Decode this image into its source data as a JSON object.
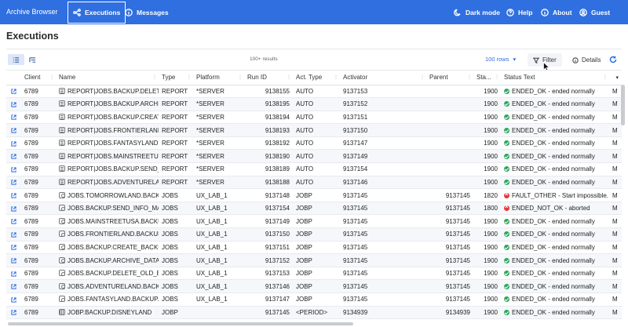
{
  "app": {
    "title": "Archive Browser"
  },
  "nav": {
    "executions": "Executions",
    "messages": "Messages",
    "dark_mode": "Dark mode",
    "help": "Help",
    "about": "About",
    "guest": "Guest"
  },
  "page": {
    "title": "Executions"
  },
  "toolbar": {
    "results": "100+ results",
    "rows": "100 rows",
    "filter": "Filter",
    "details": "Details"
  },
  "colors": {
    "topbar": "#2f6fe0",
    "ok": "#2aa65a",
    "error": "#e03b3b"
  },
  "columns": [
    "Client",
    "Name",
    "Type",
    "Platform",
    "Run ID",
    "Act. Type",
    "Activator",
    "Parent",
    "Sta...",
    "Status Text"
  ],
  "rows": [
    {
      "client": "6789",
      "icon": "report",
      "name": "REPORT|JOBS.BACKUP.DELETE_C",
      "type": "REPORT",
      "platform": "*SERVER",
      "run_id": "9138155",
      "act_type": "AUTO",
      "activator": "9137153",
      "parent": "",
      "sta": "1900",
      "st": "ok",
      "status": "ENDED_OK - ended normally",
      "extra": "M"
    },
    {
      "client": "6789",
      "icon": "report",
      "name": "REPORT|JOBS.BACKUP.ARCHIVE_",
      "type": "REPORT",
      "platform": "*SERVER",
      "run_id": "9138195",
      "act_type": "AUTO",
      "activator": "9137152",
      "parent": "",
      "sta": "1900",
      "st": "ok",
      "status": "ENDED_OK - ended normally",
      "extra": "M"
    },
    {
      "client": "6789",
      "icon": "report",
      "name": "REPORT|JOBS.BACKUP.CREATE_E",
      "type": "REPORT",
      "platform": "*SERVER",
      "run_id": "9138194",
      "act_type": "AUTO",
      "activator": "9137151",
      "parent": "",
      "sta": "1900",
      "st": "ok",
      "status": "ENDED_OK - ended normally",
      "extra": "M"
    },
    {
      "client": "6789",
      "icon": "report",
      "name": "REPORT|JOBS.FRONTIERLAND.BA",
      "type": "REPORT",
      "platform": "*SERVER",
      "run_id": "9138193",
      "act_type": "AUTO",
      "activator": "9137150",
      "parent": "",
      "sta": "1900",
      "st": "ok",
      "status": "ENDED_OK - ended normally",
      "extra": "M"
    },
    {
      "client": "6789",
      "icon": "report",
      "name": "REPORT|JOBS.FANTASYLAND.BAG",
      "type": "REPORT",
      "platform": "*SERVER",
      "run_id": "9138192",
      "act_type": "AUTO",
      "activator": "9137147",
      "parent": "",
      "sta": "1900",
      "st": "ok",
      "status": "ENDED_OK - ended normally",
      "extra": "M"
    },
    {
      "client": "6789",
      "icon": "report",
      "name": "REPORT|JOBS.MAINSTREETUSA.E",
      "type": "REPORT",
      "platform": "*SERVER",
      "run_id": "9138190",
      "act_type": "AUTO",
      "activator": "9137149",
      "parent": "",
      "sta": "1900",
      "st": "ok",
      "status": "ENDED_OK - ended normally",
      "extra": "M"
    },
    {
      "client": "6789",
      "icon": "report",
      "name": "REPORT|JOBS.BACKUP.SEND_INF",
      "type": "REPORT",
      "platform": "*SERVER",
      "run_id": "9138189",
      "act_type": "AUTO",
      "activator": "9137154",
      "parent": "",
      "sta": "1900",
      "st": "ok",
      "status": "ENDED_OK - ended normally",
      "extra": "M"
    },
    {
      "client": "6789",
      "icon": "report",
      "name": "REPORT|JOBS.ADVENTURELAND.",
      "type": "REPORT",
      "platform": "*SERVER",
      "run_id": "9138188",
      "act_type": "AUTO",
      "activator": "9137146",
      "parent": "",
      "sta": "1900",
      "st": "ok",
      "status": "ENDED_OK - ended normally",
      "extra": "M"
    },
    {
      "client": "6789",
      "icon": "job",
      "name": "JOBS.TOMORROWLAND.BACKUP",
      "type": "JOBS",
      "platform": "UX_LAB_1",
      "run_id": "9137148",
      "act_type": "JOBP",
      "activator": "9137145",
      "parent": "9137145",
      "sta": "1820",
      "st": "err",
      "status": "FAULT_OTHER - Start impossible. C",
      "extra": "M"
    },
    {
      "client": "6789",
      "icon": "job",
      "name": "JOBS.BACKUP.SEND_INFO_MAIL",
      "type": "JOBS",
      "platform": "UX_LAB_1",
      "run_id": "9137154",
      "act_type": "JOBP",
      "activator": "9137145",
      "parent": "9137145",
      "sta": "1800",
      "st": "err",
      "status": "ENDED_NOT_OK - aborted",
      "extra": "M"
    },
    {
      "client": "6789",
      "icon": "job",
      "name": "JOBS.MAINSTREETUSA.BACKUP",
      "type": "JOBS",
      "platform": "UX_LAB_1",
      "run_id": "9137149",
      "act_type": "JOBP",
      "activator": "9137145",
      "parent": "9137145",
      "sta": "1900",
      "st": "ok",
      "status": "ENDED_OK - ended normally",
      "extra": "M"
    },
    {
      "client": "6789",
      "icon": "job",
      "name": "JOBS.FRONTIERLAND.BACKUP.C",
      "type": "JOBS",
      "platform": "UX_LAB_1",
      "run_id": "9137150",
      "act_type": "JOBP",
      "activator": "9137145",
      "parent": "9137145",
      "sta": "1900",
      "st": "ok",
      "status": "ENDED_OK - ended normally",
      "extra": "M"
    },
    {
      "client": "6789",
      "icon": "job",
      "name": "JOBS.BACKUP.CREATE_BACKUF",
      "type": "JOBS",
      "platform": "UX_LAB_1",
      "run_id": "9137151",
      "act_type": "JOBP",
      "activator": "9137145",
      "parent": "9137145",
      "sta": "1900",
      "st": "ok",
      "status": "ENDED_OK - ended normally",
      "extra": "M"
    },
    {
      "client": "6789",
      "icon": "job",
      "name": "JOBS.BACKUP.ARCHIVE_DATA",
      "type": "JOBS",
      "platform": "UX_LAB_1",
      "run_id": "9137152",
      "act_type": "JOBP",
      "activator": "9137145",
      "parent": "9137145",
      "sta": "1900",
      "st": "ok",
      "status": "ENDED_OK - ended normally",
      "extra": "M"
    },
    {
      "client": "6789",
      "icon": "job",
      "name": "JOBS.BACKUP.DELETE_OLD_BACI",
      "type": "JOBS",
      "platform": "UX_LAB_1",
      "run_id": "9137153",
      "act_type": "JOBP",
      "activator": "9137145",
      "parent": "9137145",
      "sta": "1900",
      "st": "ok",
      "status": "ENDED_OK - ended normally",
      "extra": "M"
    },
    {
      "client": "6789",
      "icon": "job",
      "name": "JOBS.ADVENTURELAND.BACKUP",
      "type": "JOBS",
      "platform": "UX_LAB_1",
      "run_id": "9137146",
      "act_type": "JOBP",
      "activator": "9137145",
      "parent": "9137145",
      "sta": "1900",
      "st": "ok",
      "status": "ENDED_OK - ended normally",
      "extra": "M"
    },
    {
      "client": "6789",
      "icon": "job",
      "name": "JOBS.FANTASYLAND.BACKUP.CO",
      "type": "JOBS",
      "platform": "UX_LAB_1",
      "run_id": "9137147",
      "act_type": "JOBP",
      "activator": "9137145",
      "parent": "9137145",
      "sta": "1900",
      "st": "ok",
      "status": "ENDED_OK - ended normally",
      "extra": "M"
    },
    {
      "client": "6789",
      "icon": "plan",
      "name": "JOBP.BACKUP.DISNEYLAND",
      "type": "JOBP",
      "platform": "",
      "run_id": "9137145",
      "act_type": "<PERIOD>",
      "activator": "9134939",
      "parent": "9134939",
      "sta": "1900",
      "st": "ok",
      "status": "ENDED_OK - ended normally",
      "extra": "M"
    }
  ]
}
